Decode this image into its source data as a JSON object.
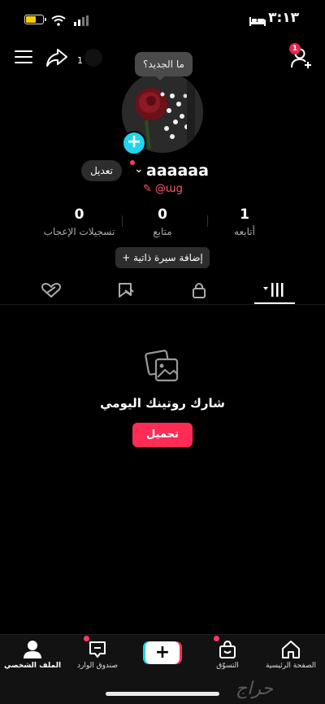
{
  "status_bar": {
    "time": "٣:١٣"
  },
  "top_bar": {
    "share_count": "1",
    "notification_count": "1",
    "tooltip": "ما الجديد؟"
  },
  "profile": {
    "edit_label": "تعديل",
    "username": "aaaaaa",
    "handle": "@աց",
    "add_bio_label": "إضافة سيرة ذاتية"
  },
  "stats": [
    {
      "value": "1",
      "label": "أتابعه"
    },
    {
      "value": "0",
      "label": "متابع"
    },
    {
      "value": "0",
      "label": "تسجيلات الإعجاب"
    }
  ],
  "tabs": [
    {
      "icon": "videos-grid-icon"
    },
    {
      "icon": "lock-icon"
    },
    {
      "icon": "reposts-icon"
    },
    {
      "icon": "liked-icon"
    }
  ],
  "empty_state": {
    "title": "شارك روتينك اليومي",
    "button": "تحميل"
  },
  "bottom_nav": {
    "home": "الصفحة الرئيسية",
    "shop": "التسوّق",
    "inbox": "صندوق الوارد",
    "profile": "الملف الشخصي"
  },
  "watermark": "حراج",
  "colors": {
    "accent": "#fe2c55",
    "cyan": "#20d5ec",
    "badge": "#e2274a"
  }
}
